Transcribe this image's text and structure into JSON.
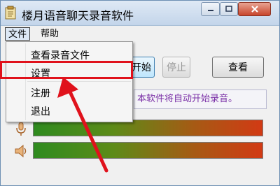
{
  "window": {
    "title": "楼月语音聊天录音软件",
    "controls": {
      "minimize": "–",
      "maximize": "□",
      "close": "✕"
    }
  },
  "menubar": {
    "items": [
      {
        "label": "文件"
      },
      {
        "label": "帮助"
      }
    ]
  },
  "file_menu": {
    "items": [
      {
        "label": "查看录音文件"
      },
      {
        "label": "设置"
      },
      {
        "label": "注册"
      },
      {
        "label": "退出"
      }
    ]
  },
  "buttons": {
    "start_partial": "开始",
    "stop": "停止",
    "view": "查看"
  },
  "notice": "本软件将自动开始录音。",
  "icons": {
    "app": "notepad-icon",
    "mic": "microphone-icon",
    "speaker": "speaker-icon"
  },
  "colors": {
    "highlight": "#e0121c",
    "notice_text": "#7a2fa6",
    "meter_start": "#2e8b1f",
    "meter_end": "#d23a14"
  }
}
